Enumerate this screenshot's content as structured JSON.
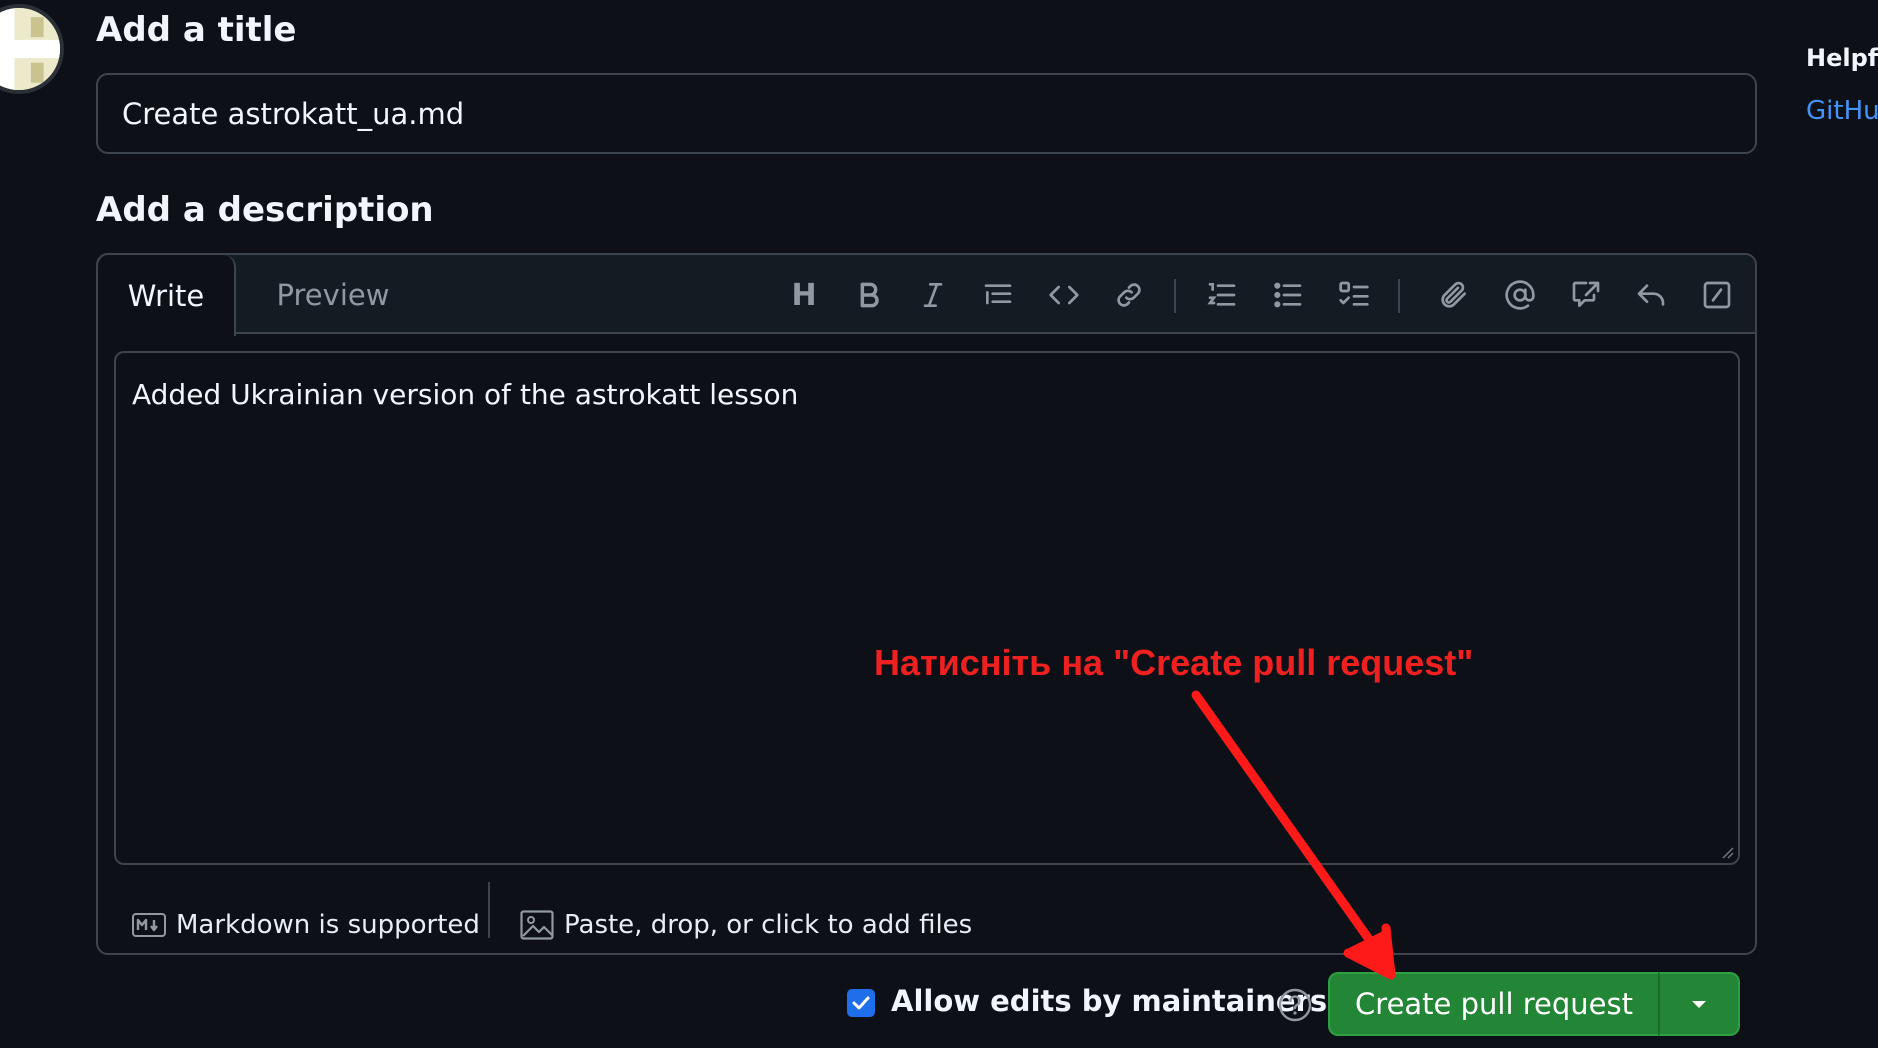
{
  "title_section": {
    "heading": "Add a title",
    "value": "Create astrokatt_ua.md"
  },
  "description_section": {
    "heading": "Add a description",
    "tabs": [
      {
        "label": "Write",
        "active": true
      },
      {
        "label": "Preview",
        "active": false
      }
    ],
    "toolbar": {
      "heading_label": "H",
      "icons": [
        "heading-icon",
        "bold-icon",
        "italic-icon",
        "quote-icon",
        "code-icon",
        "link-icon",
        "numbered-list-icon",
        "unordered-list-icon",
        "task-list-icon",
        "attach-icon",
        "mention-icon",
        "cross-reference-icon",
        "reply-icon",
        "slash-commands-icon"
      ]
    },
    "body": "Added Ukrainian version of the astrokatt lesson",
    "footer": {
      "markdown_label": "Markdown is supported",
      "files_label": "Paste, drop, or click to add files"
    }
  },
  "actions": {
    "allow_edits_label": "Allow edits by maintainers",
    "allow_edits_checked": true,
    "create_label": "Create pull request"
  },
  "sidebar": {
    "heading": "Helpful",
    "link": "GitHub"
  },
  "annotation": {
    "text": "Натисніть на \"Create pull request\"",
    "color": "#ef2020"
  },
  "colors": {
    "background": "#0d1117",
    "border": "#3d444d",
    "primary_button": "#238636",
    "checkbox": "#1f6feb",
    "link": "#4493f8"
  }
}
